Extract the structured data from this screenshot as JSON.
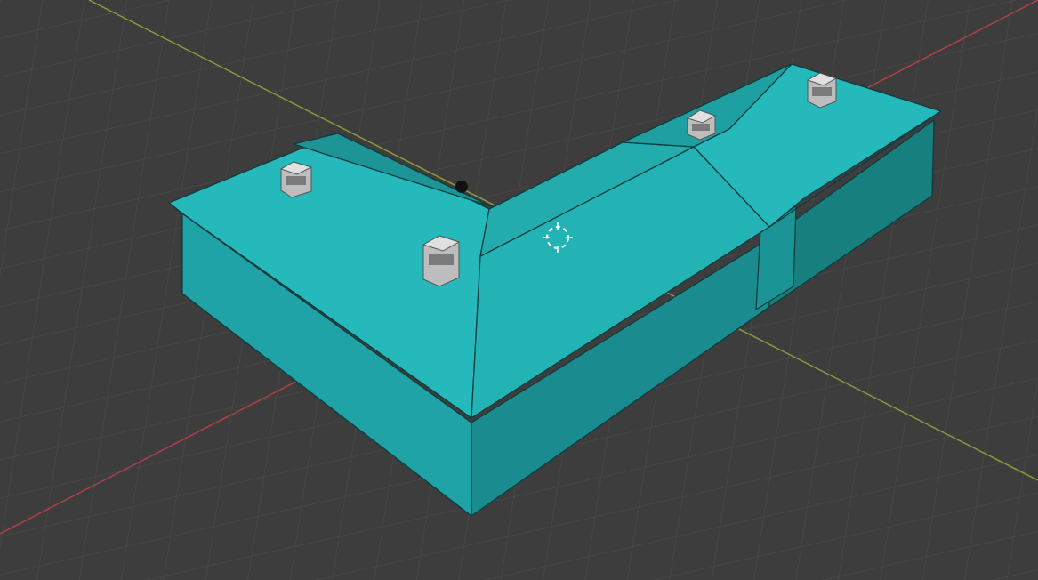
{
  "app": "3D viewport",
  "viewport": {
    "background_color": "#3d3d3d",
    "grid_color": "#4a4a4a",
    "x_axis_color": "#b0404a",
    "y_axis_color": "#8a9a3a",
    "grid_visible": true
  },
  "object": {
    "name_visible": false,
    "wall_color": "#1fa3a6",
    "roof_color": "#25b9bb",
    "roof_dark_color": "#1d9496",
    "edge_color": "#0f3c3e",
    "chimney_color": "#c8c8c8",
    "chimney_count": 4
  },
  "overlays": {
    "cursor_3d_icon": "3d-cursor-icon",
    "light_icon": "light-object-icon"
  }
}
